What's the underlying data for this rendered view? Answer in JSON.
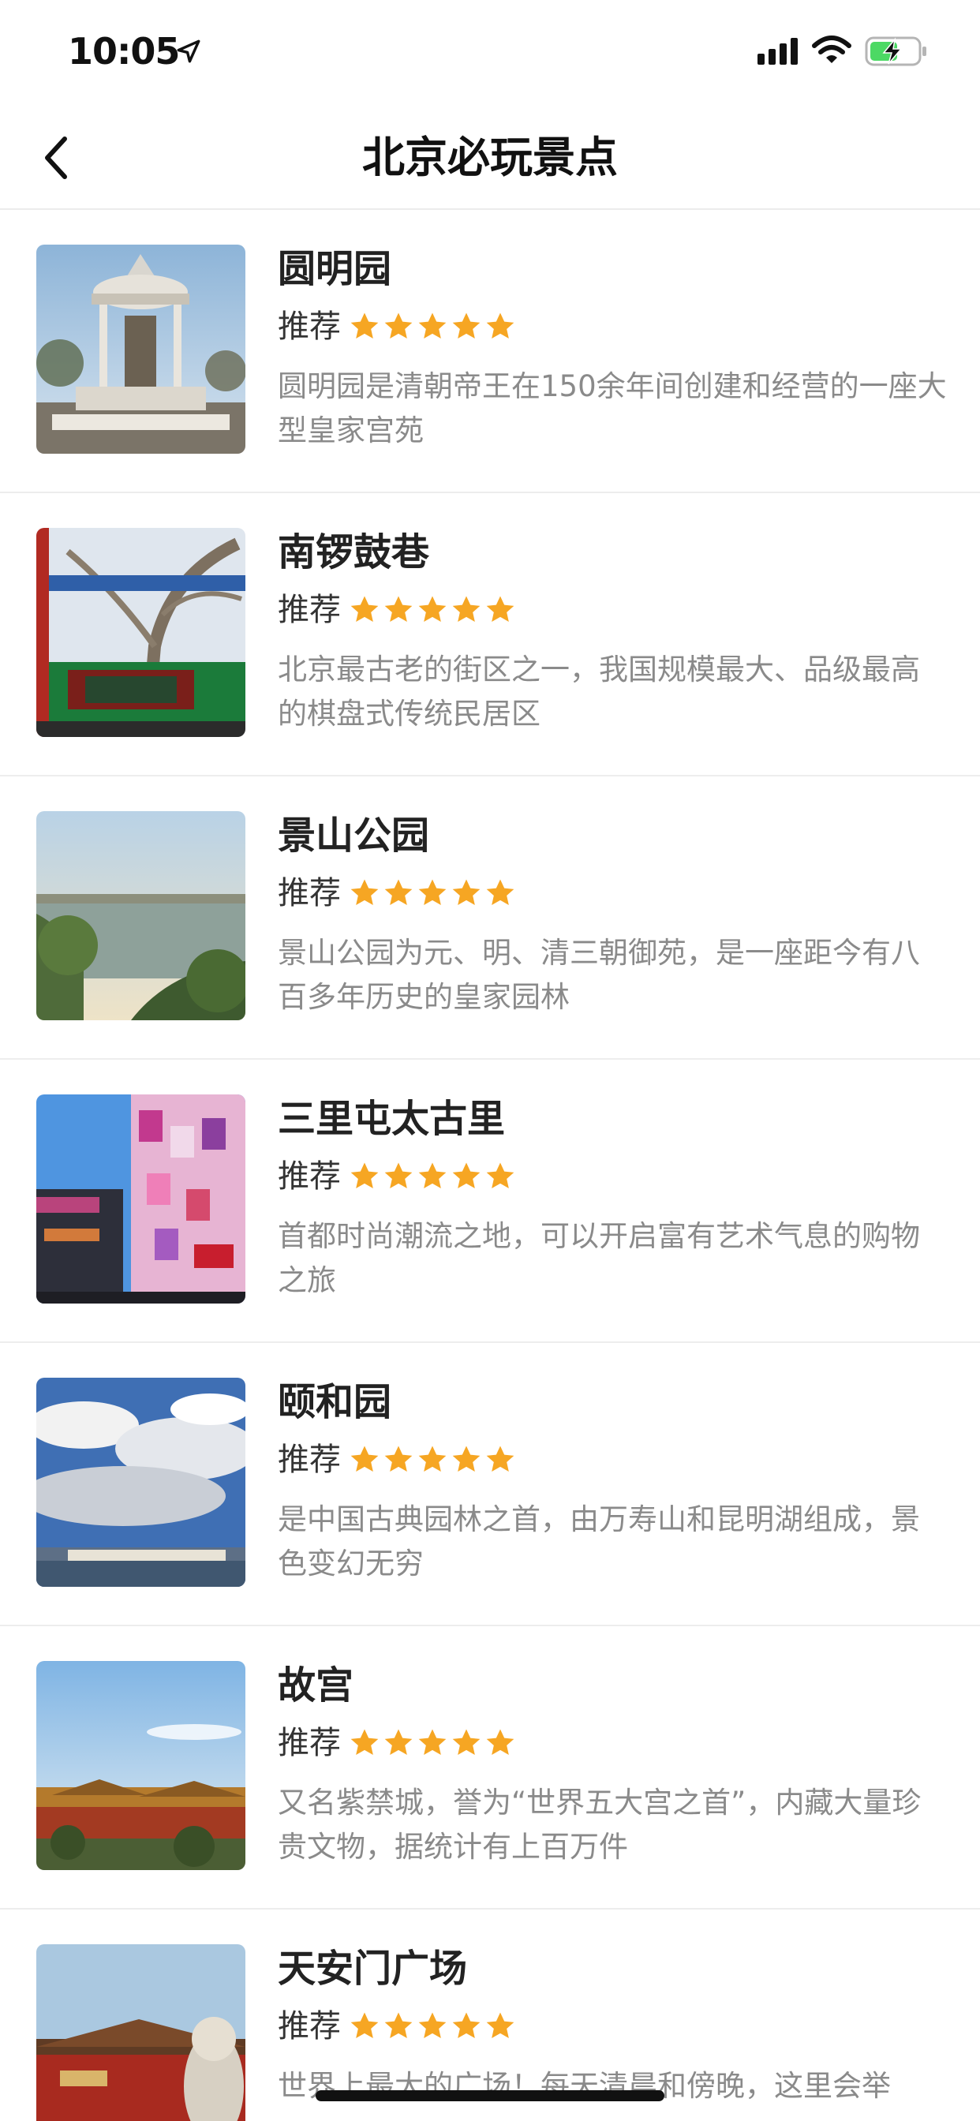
{
  "status_bar": {
    "time": "10:05",
    "icons": [
      "location-arrow-icon",
      "signal-icon",
      "wifi-icon",
      "battery-charging-icon"
    ]
  },
  "nav": {
    "title": "北京必玩景点",
    "back_icon": "chevron-left-icon"
  },
  "colors": {
    "star": "#f6a623",
    "star_light": "#ffc94a",
    "desc_text": "#8a8a8a",
    "divider": "#ededed"
  },
  "rating_stars": 5,
  "items": [
    {
      "name": "圆明园",
      "rec_label": "推荐",
      "desc": "圆明园是清朝帝王在150余年间创建和经营的一座大型皇家宫苑"
    },
    {
      "name": "南锣鼓巷",
      "rec_label": "推荐",
      "desc": "北京最古老的街区之一，我国规模最大、品级最高的棋盘式传统民居区"
    },
    {
      "name": "景山公园",
      "rec_label": "推荐",
      "desc": "景山公园为元、明、清三朝御苑，是一座距今有八百多年历史的皇家园林"
    },
    {
      "name": "三里屯太古里",
      "rec_label": "推荐",
      "desc": "首都时尚潮流之地，可以开启富有艺术气息的购物之旅"
    },
    {
      "name": "颐和园",
      "rec_label": "推荐",
      "desc": "是中国古典园林之首，由万寿山和昆明湖组成，景色变幻无穷"
    },
    {
      "name": "故宫",
      "rec_label": "推荐",
      "desc": "又名紫禁城，誉为“世界五大宫之首”，内藏大量珍贵文物，据统计有上百万件"
    },
    {
      "name": "天安门广场",
      "rec_label": "推荐",
      "desc": "世界上最大的广场！每天清晨和傍晚，这里会举"
    }
  ]
}
